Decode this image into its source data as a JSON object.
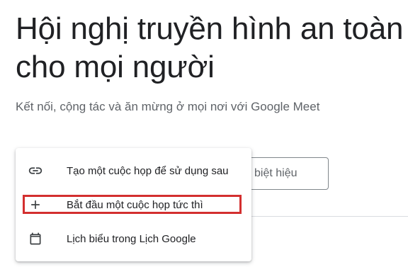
{
  "hero": {
    "title_line1": "Hội nghị truyền hình an toàn",
    "title_line2": "cho mọi người",
    "subtitle": "Kết nối, cộng tác và ăn mừng ở mọi nơi với Google Meet"
  },
  "join": {
    "code_input_partial": "biệt hiệu"
  },
  "new_meeting_menu": {
    "items": [
      {
        "label": "Tạo một cuộc họp để sử dụng sau",
        "icon": "link-icon"
      },
      {
        "label": "Bắt đầu một cuộc họp tức thì",
        "icon": "plus-icon",
        "highlighted": true
      },
      {
        "label": "Lịch biểu trong Lịch Google",
        "icon": "calendar-icon"
      }
    ]
  },
  "colors": {
    "highlight_border": "#d32f2f",
    "text_primary": "#202124",
    "text_secondary": "#5f6368"
  }
}
